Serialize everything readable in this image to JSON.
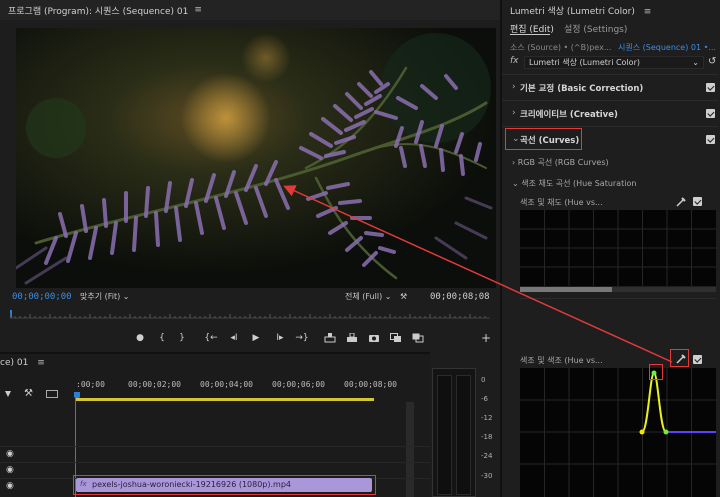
{
  "program": {
    "title": "프로그램 (Program): 시퀀스 (Sequence) 01",
    "menu": "≡",
    "timecode_current": "00;00;00;00",
    "fit_label": "맞추기 (Fit)",
    "full_label": "전체 (Full)",
    "timecode_duration": "00;00;08;08",
    "transport": {
      "marker": "●",
      "in": "{",
      "out": "}",
      "go_in": "{←",
      "step_back": "◂I",
      "play": "▶",
      "step_fwd": "I▸",
      "go_out": "→}",
      "add": "+"
    }
  },
  "lumetri": {
    "title": "Lumetri 색상 (Lumetri Color)",
    "menu": "≡",
    "tab_edit": "편집 (Edit)",
    "tab_settings": "설정 (Settings)",
    "source_part": "소스 (Source) • (^B)pex...",
    "sequence_part": "시퀀스 (Sequence) 01 •...",
    "fx_label": "fx",
    "effect_name": "Lumetri 색상 (Lumetri Color)",
    "sections": {
      "basic": "기본 교정 (Basic Correction)",
      "creative": "크리에이티브 (Creative)",
      "curves": "곡선 (Curves)"
    },
    "rgb_curves": "RGB 곡선 (RGB Curves)",
    "hue_saturation": "색조 채도 곡선 (Hue Saturation",
    "graph1_label": "색조 및 채도 (Hue vs...",
    "graph2_label": "색조 및 색조 (Hue vs...",
    "colors": {
      "accent_red": "#e23a3a",
      "curve_yellow": "#f2e600",
      "curve_green": "#6cf03a"
    }
  },
  "timeline": {
    "title": "ce) 01",
    "menu": "≡",
    "ruler": [
      ":00;00",
      "00;00;02;00",
      "00;00;04;00",
      "00;00;06;00",
      "00;00;08;00"
    ],
    "clip_name": "pexels-joshua-woroniecki-19216926 (1080p).mp4",
    "clip_fx": "fx",
    "db_scale": [
      "0",
      "-6",
      "-12",
      "-18",
      "-24",
      "-30"
    ]
  }
}
